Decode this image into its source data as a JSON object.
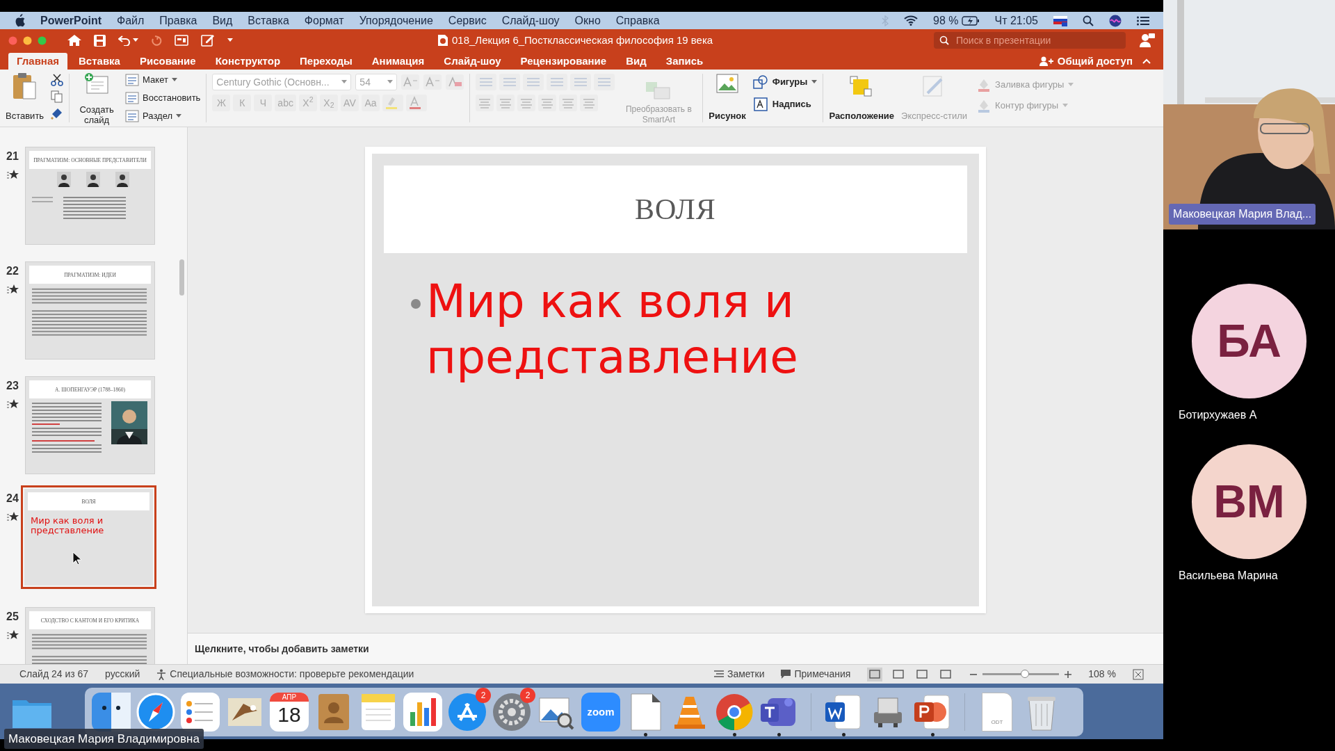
{
  "menu_bar": {
    "app": "PowerPoint",
    "items": [
      "Файл",
      "Правка",
      "Вид",
      "Вставка",
      "Формат",
      "Упорядочение",
      "Сервис",
      "Слайд-шоу",
      "Окно",
      "Справка"
    ],
    "battery": "98 %",
    "clock": "Чт 21:05"
  },
  "title_bar": {
    "title": "018_Лекция 6_Постклассическая философия 19 века",
    "search": {
      "placeholder": "Поиск в презентации"
    }
  },
  "ribbon_tabs": [
    {
      "label": "Главная",
      "selected": true
    },
    {
      "label": "Вставка",
      "selected": false
    },
    {
      "label": "Рисование",
      "selected": false
    },
    {
      "label": "Конструктор",
      "selected": false
    },
    {
      "label": "Переходы",
      "selected": false
    },
    {
      "label": "Анимация",
      "selected": false
    },
    {
      "label": "Слайд-шоу",
      "selected": false
    },
    {
      "label": "Рецензирование",
      "selected": false
    },
    {
      "label": "Вид",
      "selected": false
    },
    {
      "label": "Запись",
      "selected": false
    }
  ],
  "share": "Общий доступ",
  "ribbon": {
    "paste": "Вставить",
    "new_slide": "Создать слайд",
    "layout": "Макет",
    "reset": "Восстановить",
    "section": "Раздел",
    "font": "Century Gothic (Основн...",
    "font_size": "54",
    "format_buttons": [
      "Ж",
      "К",
      "Ч",
      "abc",
      "X$^{2}$",
      "X$_{2}$",
      "AV",
      "Aa"
    ],
    "smartart": {
      "label": "Преобразовать в SmartArt",
      "disabled": true
    },
    "picture": "Рисунок",
    "shapes": "Фигуры",
    "textbox": "Надпись",
    "arrange": "Расположение",
    "quick_styles": {
      "label": "Экспресс-стили",
      "disabled": true
    },
    "shape_fill": {
      "label": "Заливка фигуры",
      "disabled": true
    },
    "shape_outline": {
      "label": "Контур фигуры",
      "disabled": true
    }
  },
  "slides": [
    {
      "number": "21",
      "title": "ПРАГМАТИЗМ: ОСНОВНЫЕ ПРЕДСТАВИТЕЛИ",
      "kind": "portraits",
      "selected": false
    },
    {
      "number": "22",
      "title": "ПРАГМАТИЗМ: ИДЕИ",
      "kind": "text",
      "selected": false
    },
    {
      "number": "23",
      "title": "А. ШОПЕНГАУЭР (1788–1860)",
      "kind": "portrait",
      "selected": false
    },
    {
      "number": "24",
      "title": "ВОЛЯ",
      "kind": "bullet",
      "text": "Мир как воля и представление",
      "selected": true
    },
    {
      "number": "25",
      "title": "СХОДСТВО С КАНТОМ И ЕГО КРИТИКА",
      "kind": "text",
      "selected": false
    }
  ],
  "slide": {
    "title": "ВОЛЯ",
    "bullet": "Мир как воля и представление"
  },
  "notes": {
    "placeholder": "Щелкните, чтобы добавить заметки"
  },
  "status_bar": {
    "slide": "Слайд 24 из 67",
    "language": "русский",
    "accessibility": "Специальные возможности: проверьте рекомендации",
    "notes": "Заметки",
    "comments": "Примечания",
    "zoom": "108 %",
    "zoom_level": {
      "level": 0.55
    }
  },
  "dock": [
    {
      "kind": "finder",
      "running": false
    },
    {
      "kind": "safari",
      "running": false
    },
    {
      "kind": "reminders",
      "running": false
    },
    {
      "kind": "mail",
      "running": false
    },
    {
      "kind": "calendar",
      "month": "АПР",
      "day": "18",
      "running": false
    },
    {
      "kind": "contacts",
      "running": false
    },
    {
      "kind": "notes",
      "running": false
    },
    {
      "kind": "numbers",
      "running": false
    },
    {
      "kind": "appstore",
      "badge": "2",
      "running": false
    },
    {
      "kind": "settings",
      "badge": "2",
      "running": false
    },
    {
      "kind": "preview",
      "running": false
    },
    {
      "kind": "zoom",
      "label": "zoom",
      "running": false
    },
    {
      "kind": "libreoffice",
      "running": true
    },
    {
      "kind": "vlc",
      "running": false
    },
    {
      "kind": "chrome",
      "running": true
    },
    {
      "kind": "teams",
      "running": true
    },
    {
      "kind": "separator"
    },
    {
      "kind": "word",
      "running": true
    },
    {
      "kind": "scanner",
      "running": false
    },
    {
      "kind": "powerpoint",
      "running": true
    },
    {
      "kind": "separator"
    },
    {
      "kind": "document",
      "label": "ODT",
      "running": false
    },
    {
      "kind": "trash",
      "running": false
    }
  ],
  "self_view": {
    "name": "Маковецкая Мария Владимировна"
  },
  "participants": [
    {
      "kind": "video",
      "name": "Маковецкая Мария Влад..."
    },
    {
      "kind": "avatar",
      "initials": "БА",
      "name": "Ботирхужаев А",
      "color": "#f4d4df"
    },
    {
      "kind": "avatar",
      "initials": "ВМ",
      "name": "Васильева Марина",
      "color": "#f4d5cc"
    }
  ]
}
